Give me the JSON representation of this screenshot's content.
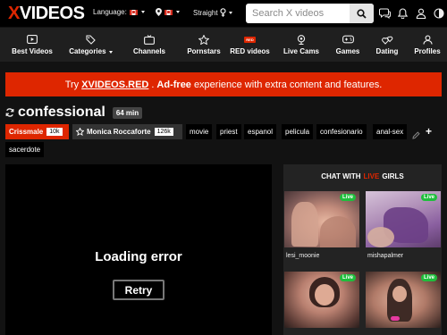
{
  "header": {
    "logo_x": "X",
    "logo_rest": "VIDEOS",
    "language_label": "Language:",
    "orientation_label": "Straight",
    "search_placeholder": "Search X videos"
  },
  "nav": {
    "items": [
      {
        "label": "Best Videos",
        "icon": "play-square-icon"
      },
      {
        "label": "Categories",
        "icon": "tag-icon"
      },
      {
        "label": "Channels",
        "icon": "tv-icon"
      },
      {
        "label": "Pornstars",
        "icon": "star-icon"
      },
      {
        "label": "RED videos",
        "icon": "red-badge-icon",
        "badge": "RED"
      },
      {
        "label": "Live Cams",
        "icon": "webcam-icon"
      },
      {
        "label": "Games",
        "icon": "gamepad-icon"
      },
      {
        "label": "Dating",
        "icon": "hearts-icon"
      },
      {
        "label": "Profiles",
        "icon": "user-icon"
      }
    ]
  },
  "banner": {
    "pre": "Try",
    "brand": "XVIDEOS.RED",
    "bold": "Ad-free",
    "post": "experience with extra content and features."
  },
  "video": {
    "title": "confessional",
    "duration": "64 min"
  },
  "tags": {
    "models": [
      {
        "name": "Crissmale",
        "count": "10k"
      },
      {
        "name": "Monica Roccaforte",
        "count": "126k"
      }
    ],
    "keywords": [
      "movie",
      "priest",
      "espanol",
      "pelicula",
      "confesionario",
      "anal-sex",
      "sacerdote"
    ]
  },
  "player": {
    "error_text": "Loading error",
    "retry_label": "Retry"
  },
  "live_panel": {
    "heading_pre": "CHAT WITH",
    "heading_live": "LIVE",
    "heading_post": "GIRLS",
    "badge": "Live",
    "cams": [
      {
        "name": "lesi_moonie"
      },
      {
        "name": "mishapalmer"
      },
      {
        "name": ""
      },
      {
        "name": ""
      }
    ]
  },
  "colors": {
    "brand_red": "#de2600",
    "live_green": "#1fbe3c",
    "background": "#121212"
  }
}
